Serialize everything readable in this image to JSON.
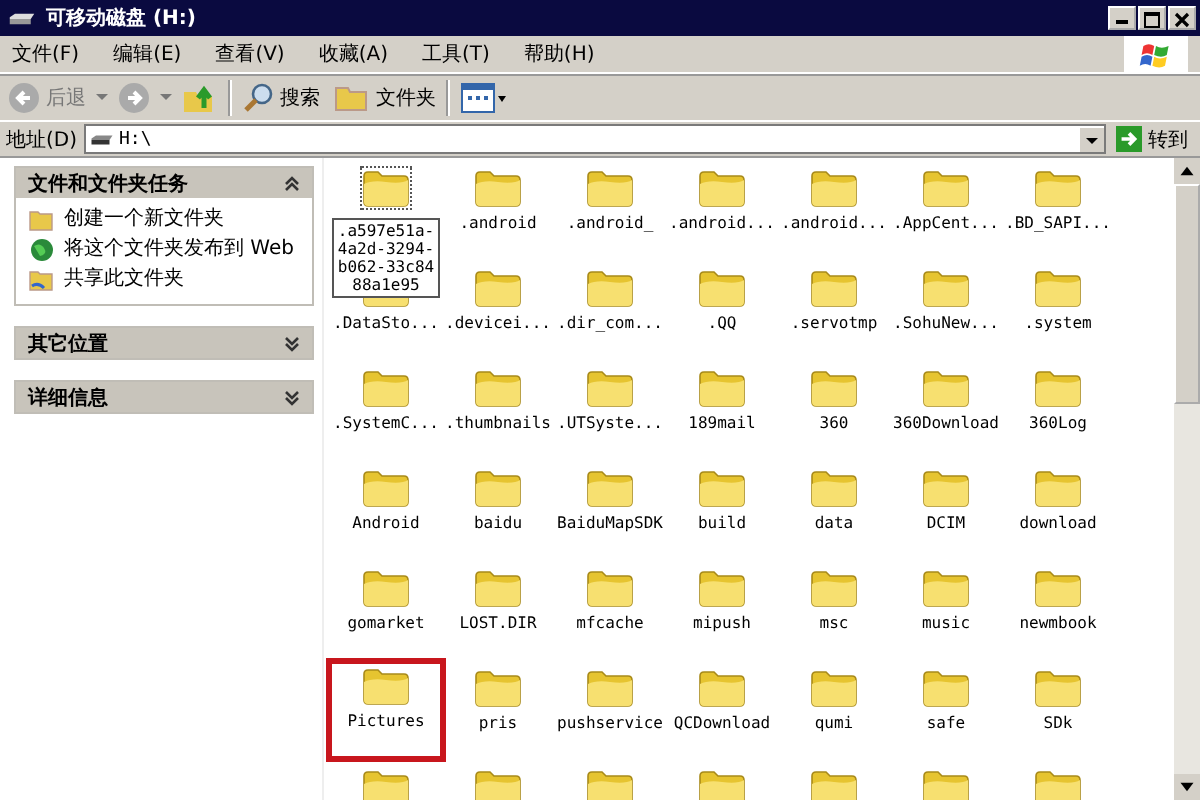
{
  "window": {
    "title": "可移动磁盘 (H:)"
  },
  "menu": [
    "文件(F)",
    "编辑(E)",
    "查看(V)",
    "收藏(A)",
    "工具(T)",
    "帮助(H)"
  ],
  "toolbar": {
    "back": "后退",
    "search": "搜索",
    "folders": "文件夹"
  },
  "address": {
    "label": "地址(D)",
    "value": "H:\\",
    "go": "转到"
  },
  "sidebar": [
    {
      "title": "文件和文件夹任务",
      "expanded": true,
      "items": [
        {
          "kind": "new-folder",
          "label": "创建一个新文件夹"
        },
        {
          "kind": "publish",
          "label": "将这个文件夹发布到 Web"
        },
        {
          "kind": "share",
          "label": "共享此文件夹"
        }
      ]
    },
    {
      "title": "其它位置",
      "expanded": false
    },
    {
      "title": "详细信息",
      "expanded": false
    }
  ],
  "folders": [
    {
      "name": ".a597e51a-4a2d-3294-b062-33c8488a1e95",
      "focused": true,
      "highlighted": false
    },
    {
      "name": ".android",
      "focused": false,
      "highlighted": false
    },
    {
      "name": ".android_",
      "focused": false,
      "highlighted": false
    },
    {
      "name": ".android...",
      "focused": false,
      "highlighted": false
    },
    {
      "name": ".android...",
      "focused": false,
      "highlighted": false
    },
    {
      "name": ".AppCent...",
      "focused": false,
      "highlighted": false
    },
    {
      "name": ".BD_SAPI...",
      "focused": false,
      "highlighted": false
    },
    {
      "name": ".DataSto...",
      "focused": false,
      "highlighted": false
    },
    {
      "name": ".devicei...",
      "focused": false,
      "highlighted": false
    },
    {
      "name": ".dir_com...",
      "focused": false,
      "highlighted": false
    },
    {
      "name": ".QQ",
      "focused": false,
      "highlighted": false
    },
    {
      "name": ".servotmp",
      "focused": false,
      "highlighted": false
    },
    {
      "name": ".SohuNew...",
      "focused": false,
      "highlighted": false
    },
    {
      "name": ".system",
      "focused": false,
      "highlighted": false
    },
    {
      "name": ".SystemC...",
      "focused": false,
      "highlighted": false
    },
    {
      "name": ".thumbnails",
      "focused": false,
      "highlighted": false
    },
    {
      "name": ".UTSyste...",
      "focused": false,
      "highlighted": false
    },
    {
      "name": "189mail",
      "focused": false,
      "highlighted": false
    },
    {
      "name": "360",
      "focused": false,
      "highlighted": false
    },
    {
      "name": "360Download",
      "focused": false,
      "highlighted": false
    },
    {
      "name": "360Log",
      "focused": false,
      "highlighted": false
    },
    {
      "name": "Android",
      "focused": false,
      "highlighted": false
    },
    {
      "name": "baidu",
      "focused": false,
      "highlighted": false
    },
    {
      "name": "BaiduMapSDK",
      "focused": false,
      "highlighted": false
    },
    {
      "name": "build",
      "focused": false,
      "highlighted": false
    },
    {
      "name": "data",
      "focused": false,
      "highlighted": false
    },
    {
      "name": "DCIM",
      "focused": false,
      "highlighted": false
    },
    {
      "name": "download",
      "focused": false,
      "highlighted": false
    },
    {
      "name": "gomarket",
      "focused": false,
      "highlighted": false
    },
    {
      "name": "LOST.DIR",
      "focused": false,
      "highlighted": false
    },
    {
      "name": "mfcache",
      "focused": false,
      "highlighted": false
    },
    {
      "name": "mipush",
      "focused": false,
      "highlighted": false
    },
    {
      "name": "msc",
      "focused": false,
      "highlighted": false
    },
    {
      "name": "music",
      "focused": false,
      "highlighted": false
    },
    {
      "name": "newmbook",
      "focused": false,
      "highlighted": false
    },
    {
      "name": "Pictures",
      "focused": false,
      "highlighted": true
    },
    {
      "name": "pris",
      "focused": false,
      "highlighted": false
    },
    {
      "name": "pushservice",
      "focused": false,
      "highlighted": false
    },
    {
      "name": "QCDownload",
      "focused": false,
      "highlighted": false
    },
    {
      "name": "qumi",
      "focused": false,
      "highlighted": false
    },
    {
      "name": "safe",
      "focused": false,
      "highlighted": false
    },
    {
      "name": "SDk",
      "focused": false,
      "highlighted": false
    },
    {
      "focused": false,
      "highlighted": false
    },
    {
      "focused": false,
      "highlighted": false
    },
    {
      "focused": false,
      "highlighted": false
    },
    {
      "focused": false,
      "highlighted": false
    },
    {
      "focused": false,
      "highlighted": false
    },
    {
      "focused": false,
      "highlighted": false
    },
    {
      "focused": false,
      "highlighted": false
    }
  ]
}
